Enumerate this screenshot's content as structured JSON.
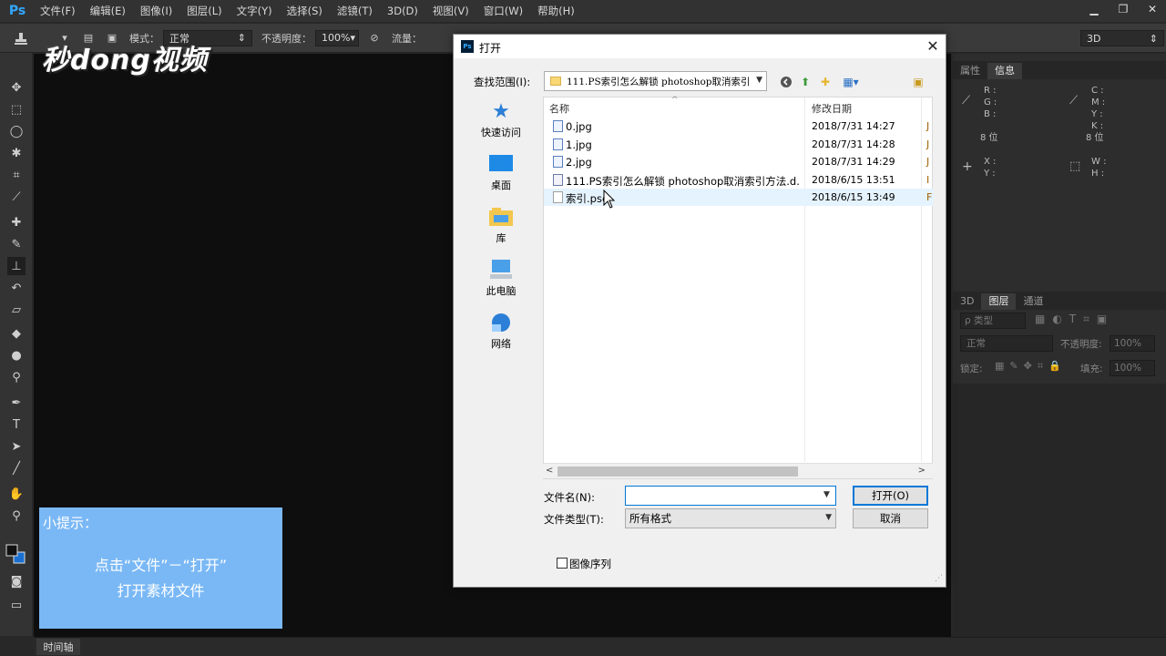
{
  "app": {
    "logo": "Ps"
  },
  "menu": [
    "文件(F)",
    "编辑(E)",
    "图像(I)",
    "图层(L)",
    "文字(Y)",
    "选择(S)",
    "滤镜(T)",
    "3D(D)",
    "视图(V)",
    "窗口(W)",
    "帮助(H)"
  ],
  "options_bar": {
    "mode_label": "模式：",
    "mode_value": "正常",
    "opacity_label": "不透明度：",
    "opacity_value": "100%",
    "flow_label": "流量：",
    "workspace_value": "3D"
  },
  "watermark": "秒dong视频",
  "right_panel": {
    "tabs_top": [
      "属性",
      "信息"
    ],
    "info": {
      "r": "R :",
      "g": "G :",
      "b": "B :",
      "c": "C :",
      "m": "M :",
      "y": "Y :",
      "k": "K :",
      "bit_left": "8 位",
      "bit_right": "8 位",
      "x": "X :",
      "ylbl": "Y :",
      "w": "W :",
      "h": "H :"
    },
    "tabs_layers": [
      "3D",
      "图层",
      "通道"
    ],
    "layer_filter": "ρ 类型",
    "blend_mode": "正常",
    "opacity_label": "不透明度:",
    "opacity_value": "100%",
    "lock_label": "锁定:",
    "fill_label": "填充:",
    "fill_value": "100%"
  },
  "timeline_tab": "时间轴",
  "tip": {
    "title": "小提示：",
    "line1": "点击“文件”－“打开”",
    "line2": "打开素材文件"
  },
  "dialog": {
    "title": "打开",
    "close": "✕",
    "lookin_label": "查找范围(I):",
    "lookin_value": "111.PS索引怎么解锁 photoshop取消索引",
    "places": [
      "快速访问",
      "桌面",
      "库",
      "此电脑",
      "网络"
    ],
    "columns": {
      "name": "名称",
      "date": "修改日期"
    },
    "files": [
      {
        "name": "0.jpg",
        "date": "2018/7/31 14:27",
        "extra": "J"
      },
      {
        "name": "1.jpg",
        "date": "2018/7/31 14:28",
        "extra": "J"
      },
      {
        "name": "2.jpg",
        "date": "2018/7/31 14:29",
        "extra": "J"
      },
      {
        "name": "111.PS索引怎么解锁 photoshop取消索引方法.d...",
        "date": "2018/6/15 13:51",
        "extra": "I"
      },
      {
        "name": "索引.psd",
        "date": "2018/6/15 13:49",
        "extra": "F"
      }
    ],
    "filename_label": "文件名(N):",
    "filename_value": "",
    "filetype_label": "文件类型(T):",
    "filetype_value": "所有格式",
    "open_button": "打开(O)",
    "cancel_button": "取消",
    "image_sequence_label": "图像序列"
  },
  "colors": {
    "tip_bg": "#7ab8f5",
    "accent": "#0078d7",
    "ps_blue": "#31a8ff"
  }
}
